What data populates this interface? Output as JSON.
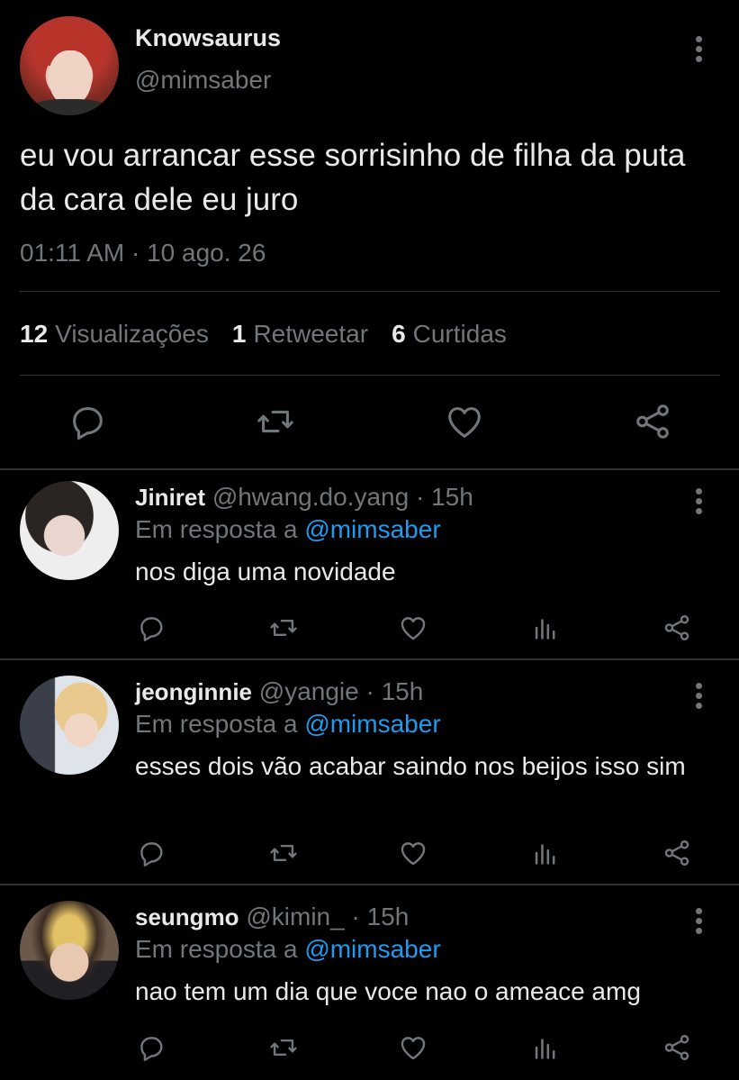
{
  "main_tweet": {
    "display_name": "Knowsaurus",
    "handle": "@mimsaber",
    "text": "eu vou arrancar esse sorrisinho de filha da puta da cara dele eu juro",
    "timestamp": "01:11 AM · 10 ago. 26",
    "stats": {
      "views_count": "12",
      "views_label": "Visualizações",
      "retweets_count": "1",
      "retweets_label": "Retweetar",
      "likes_count": "6",
      "likes_label": "Curtidas"
    },
    "actions": [
      "reply-icon",
      "retweet-icon",
      "like-icon",
      "share-icon"
    ]
  },
  "replies": [
    {
      "display_name": "Jiniret",
      "handle": "@hwang.do.yang",
      "time": "· 15h",
      "in_reply_prefix": "Em resposta a",
      "in_reply_mention": "@mimsaber",
      "text": "nos diga uma novidade"
    },
    {
      "display_name": "jeonginnie",
      "handle": "@yangie",
      "time": "· 15h",
      "in_reply_prefix": "Em resposta a",
      "in_reply_mention": "@mimsaber",
      "text": "esses dois vão acabar saindo nos beijos isso sim"
    },
    {
      "display_name": "seungmo",
      "handle": "@kimin_",
      "time": "· 15h",
      "in_reply_prefix": "Em resposta a",
      "in_reply_mention": "@mimsaber",
      "text": "nao tem um dia que voce nao o ameace amg"
    }
  ],
  "colors": {
    "background": "#000000",
    "text_primary": "#e7e9ea",
    "text_secondary": "#71767b",
    "link": "#1d9bf0",
    "divider": "#2f3336"
  }
}
